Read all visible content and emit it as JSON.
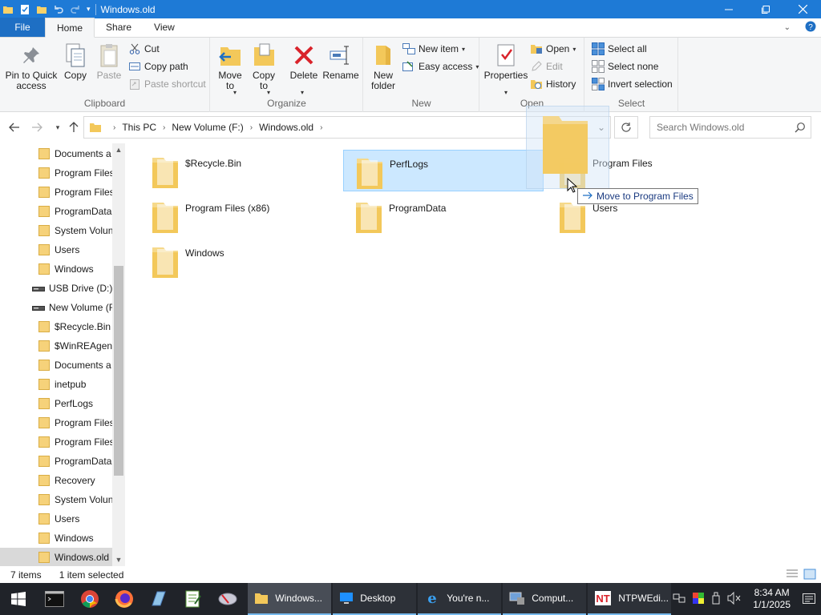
{
  "window": {
    "title": "Windows.old"
  },
  "ribbon_tabs": [
    "File",
    "Home",
    "Share",
    "View"
  ],
  "ribbon": {
    "clipboard": {
      "label": "Clipboard",
      "pin": "Pin to Quick\naccess",
      "copy": "Copy",
      "paste": "Paste",
      "cut": "Cut",
      "copy_path": "Copy path",
      "paste_shortcut": "Paste shortcut"
    },
    "organize": {
      "label": "Organize",
      "move_to": "Move\nto",
      "copy_to": "Copy\nto",
      "delete": "Delete",
      "rename": "Rename"
    },
    "new": {
      "label": "New",
      "new_folder": "New\nfolder",
      "new_item": "New item",
      "easy_access": "Easy access"
    },
    "open": {
      "label": "Open",
      "properties": "Properties",
      "open": "Open",
      "edit": "Edit",
      "history": "History"
    },
    "select": {
      "label": "Select",
      "select_all": "Select all",
      "select_none": "Select none",
      "invert": "Invert selection"
    }
  },
  "address": {
    "crumbs": [
      "This PC",
      "New Volume (F:)",
      "Windows.old"
    ]
  },
  "search": {
    "placeholder": "Search Windows.old"
  },
  "nav_tree": [
    {
      "label": "Documents a",
      "icon": "folder-icon"
    },
    {
      "label": "Program Files",
      "icon": "folder-icon"
    },
    {
      "label": "Program Files",
      "icon": "folder-icon"
    },
    {
      "label": "ProgramData",
      "icon": "folder-icon"
    },
    {
      "label": "System Volun",
      "icon": "folder-icon"
    },
    {
      "label": "Users",
      "icon": "folder-icon"
    },
    {
      "label": "Windows",
      "icon": "folder-icon"
    },
    {
      "label": "USB Drive (D:)",
      "icon": "drive-icon"
    },
    {
      "label": "New Volume (F",
      "icon": "drive-icon"
    },
    {
      "label": "$Recycle.Bin",
      "icon": "folder-icon"
    },
    {
      "label": "$WinREAgent",
      "icon": "folder-icon"
    },
    {
      "label": "Documents a",
      "icon": "folder-icon"
    },
    {
      "label": "inetpub",
      "icon": "folder-icon"
    },
    {
      "label": "PerfLogs",
      "icon": "folder-icon"
    },
    {
      "label": "Program Files",
      "icon": "folder-icon"
    },
    {
      "label": "Program Files",
      "icon": "folder-icon"
    },
    {
      "label": "ProgramData",
      "icon": "folder-icon"
    },
    {
      "label": "Recovery",
      "icon": "folder-icon"
    },
    {
      "label": "System Volun",
      "icon": "folder-icon"
    },
    {
      "label": "Users",
      "icon": "folder-icon"
    },
    {
      "label": "Windows",
      "icon": "folder-icon"
    },
    {
      "label": "Windows.old",
      "icon": "folder-icon",
      "selected": true
    }
  ],
  "files": [
    {
      "name": "$Recycle.Bin",
      "selected": false
    },
    {
      "name": "PerfLogs",
      "selected": true
    },
    {
      "name": "Program Files",
      "selected": false
    },
    {
      "name": "Program Files (x86)",
      "selected": false
    },
    {
      "name": "ProgramData",
      "selected": false
    },
    {
      "name": "Users",
      "selected": false
    },
    {
      "name": "Windows",
      "selected": false
    }
  ],
  "drag": {
    "tooltip": "Move to Program Files"
  },
  "status": {
    "items": "7 items",
    "selected": "1 item selected"
  },
  "taskbar": {
    "apps": [
      {
        "label": "Windows...",
        "icon": "folder-icon",
        "active": true
      },
      {
        "label": "Desktop",
        "icon": "desktop-icon",
        "active": false
      },
      {
        "label": "You're n...",
        "icon": "ie-icon",
        "active": false
      },
      {
        "label": "Comput...",
        "icon": "computer-management-icon",
        "active": false
      },
      {
        "label": "NTPWEdi...",
        "icon": "ntpwedit-icon",
        "active": false
      }
    ],
    "time": "8:34 AM",
    "date": "1/1/2025"
  },
  "colors": {
    "titlebar": "#1e7ad6",
    "selection": "#cce8ff",
    "folder": "#f3c85a"
  }
}
